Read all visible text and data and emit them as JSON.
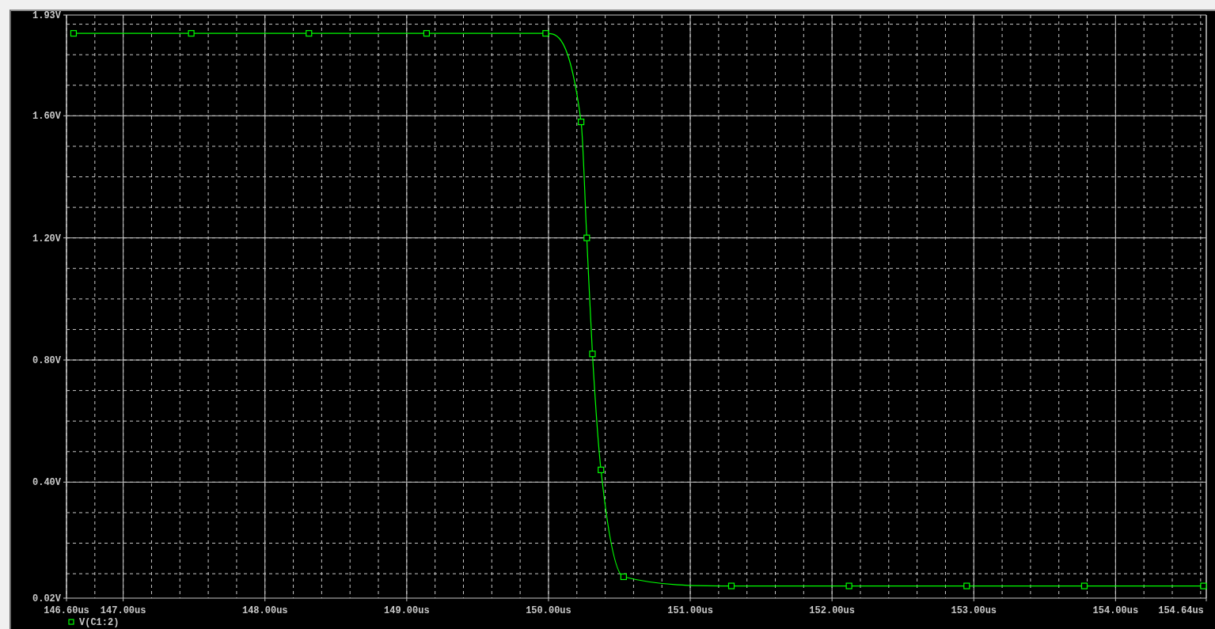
{
  "plot": {
    "chart_data": {
      "type": "line",
      "x": [
        146.65,
        147.48,
        148.31,
        149.14,
        149.98,
        150.23,
        150.27,
        150.31,
        150.37,
        150.53,
        151.29,
        152.12,
        152.95,
        153.78,
        154.62
      ],
      "grid": true,
      "series": [
        {
          "name": "V(C1:2)",
          "color": "#00ff00",
          "marker": "square",
          "values": [
            1.87,
            1.87,
            1.87,
            1.87,
            1.87,
            1.58,
            1.2,
            0.82,
            0.44,
            0.09,
            0.06,
            0.06,
            0.06,
            0.06,
            0.06
          ]
        }
      ],
      "xlim": [
        146.6,
        154.64
      ],
      "ylim": [
        0.02,
        1.93
      ],
      "xticks": [
        {
          "value": 146.6,
          "label": "146.60us"
        },
        {
          "value": 147,
          "label": "147.00us"
        },
        {
          "value": 148,
          "label": "148.00us"
        },
        {
          "value": 149,
          "label": "149.00us"
        },
        {
          "value": 150,
          "label": "150.00us"
        },
        {
          "value": 151,
          "label": "151.00us"
        },
        {
          "value": 152,
          "label": "152.00us"
        },
        {
          "value": 153,
          "label": "153.00us"
        },
        {
          "value": 154,
          "label": "154.00us"
        },
        {
          "value": 154.64,
          "label": "154.64us"
        }
      ],
      "yticks": [
        {
          "value": 0.02,
          "label": "0.02V"
        },
        {
          "value": 0.4,
          "label": "0.40V"
        },
        {
          "value": 0.8,
          "label": "0.80V"
        },
        {
          "value": 1.2,
          "label": "1.20V"
        },
        {
          "value": 1.6,
          "label": "1.60V"
        },
        {
          "value": 1.93,
          "label": "1.93V"
        }
      ]
    }
  }
}
